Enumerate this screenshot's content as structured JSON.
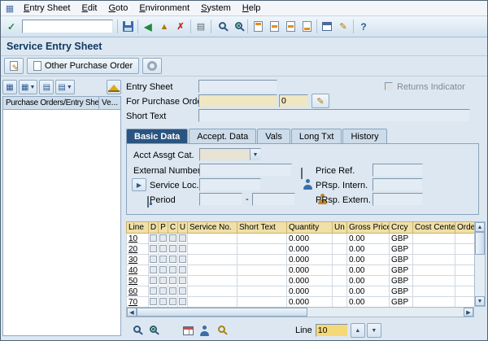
{
  "icons": {
    "window": "▦",
    "enter": "✓",
    "back": "◀",
    "exit": "▲",
    "cancel": "✗",
    "print": "▤",
    "pencil": "✎",
    "help": "?",
    "dropdown": "▼",
    "grid": "▦",
    "rows": "▤",
    "arrow_right": "▶",
    "up": "▲",
    "down": "▼",
    "left": "◀",
    "right": "▶"
  },
  "menu": {
    "items": [
      "Entry Sheet",
      "Edit",
      "Goto",
      "Environment",
      "System",
      "Help"
    ]
  },
  "title": "Service Entry Sheet",
  "app_toolbar": {
    "other_purchase_order": "Other Purchase Order"
  },
  "left_panel": {
    "col1": "Purchase Orders/Entry Sheets",
    "col2": "Ve..."
  },
  "form": {
    "entry_sheet_label": "Entry Sheet",
    "returns_indicator_label": "Returns Indicator",
    "for_purchase_order_label": "For Purchase Order",
    "po_item_value": "0",
    "short_text_label": "Short Text"
  },
  "tabs": [
    {
      "label": "Basic Data"
    },
    {
      "label": "Accept. Data"
    },
    {
      "label": "Vals"
    },
    {
      "label": "Long Txt"
    },
    {
      "label": "History"
    }
  ],
  "basic_data": {
    "acct_assgt_cat": "Acct Assgt Cat.",
    "external_number": "External Number",
    "service_loc": "Service Loc.",
    "period": "Period",
    "period_separator": "-",
    "price_ref": "Price Ref.",
    "prsp_intern": "PRsp. Intern.",
    "prsp_extern": "PRsp. Extern."
  },
  "table": {
    "columns": [
      "Line",
      "D",
      "P",
      "C",
      "U",
      "Service No.",
      "Short Text",
      "Quantity",
      "Un",
      "Gross Price",
      "Crcy",
      "Cost Center",
      "Orde.."
    ],
    "rows": [
      {
        "line": "10",
        "quantity": "0.000",
        "gross_price": "0.00",
        "currency": "GBP"
      },
      {
        "line": "20",
        "quantity": "0.000",
        "gross_price": "0.00",
        "currency": "GBP"
      },
      {
        "line": "30",
        "quantity": "0.000",
        "gross_price": "0.00",
        "currency": "GBP"
      },
      {
        "line": "40",
        "quantity": "0.000",
        "gross_price": "0.00",
        "currency": "GBP"
      },
      {
        "line": "50",
        "quantity": "0.000",
        "gross_price": "0.00",
        "currency": "GBP"
      },
      {
        "line": "60",
        "quantity": "0.000",
        "gross_price": "0.00",
        "currency": "GBP"
      },
      {
        "line": "70",
        "quantity": "0.000",
        "gross_price": "0.00",
        "currency": "GBP"
      }
    ]
  },
  "footer": {
    "line_label": "Line",
    "line_value": "10"
  }
}
